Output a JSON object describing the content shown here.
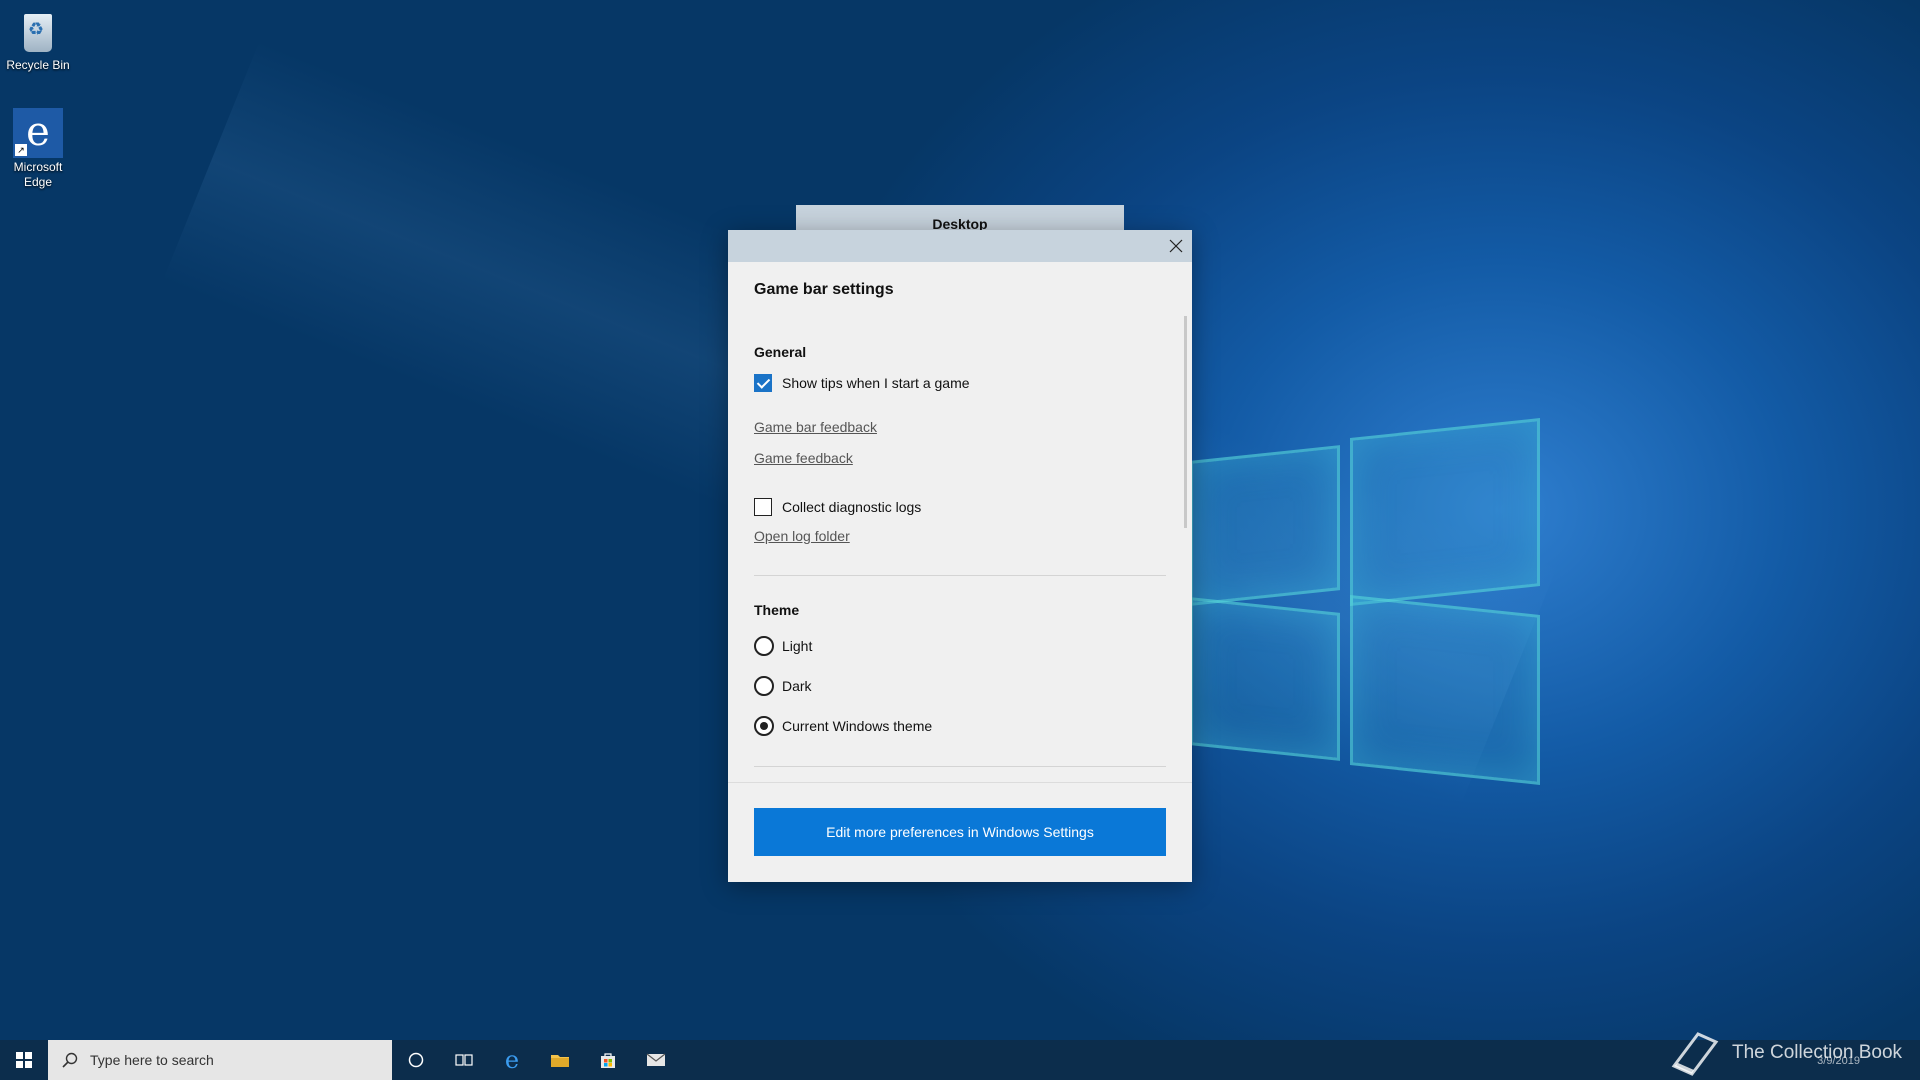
{
  "desktop": {
    "icons": [
      {
        "label": "Recycle Bin",
        "icon": "recycle-bin-icon"
      },
      {
        "label": "Microsoft Edge",
        "icon": "edge-icon"
      }
    ],
    "tab_label": "Desktop"
  },
  "dialog": {
    "title": "Game bar settings",
    "general": {
      "heading": "General",
      "show_tips": {
        "label": "Show tips when I start a game",
        "checked": true
      },
      "links": [
        "Game bar feedback",
        "Game feedback"
      ],
      "collect_logs": {
        "label": "Collect diagnostic logs",
        "checked": false
      },
      "open_log_folder": "Open log folder"
    },
    "theme": {
      "heading": "Theme",
      "options": [
        {
          "label": "Light",
          "selected": false
        },
        {
          "label": "Dark",
          "selected": false
        },
        {
          "label": "Current Windows theme",
          "selected": true
        }
      ]
    },
    "footer_button": "Edit more preferences in Windows Settings"
  },
  "taskbar": {
    "search_placeholder": "Type here to search",
    "date": "3/9/2019",
    "watermark": "The Collection Book"
  },
  "colors": {
    "accent": "#0a78d7",
    "taskbar": "#0c2d4c",
    "dialog_bg": "#f0f0f0"
  }
}
